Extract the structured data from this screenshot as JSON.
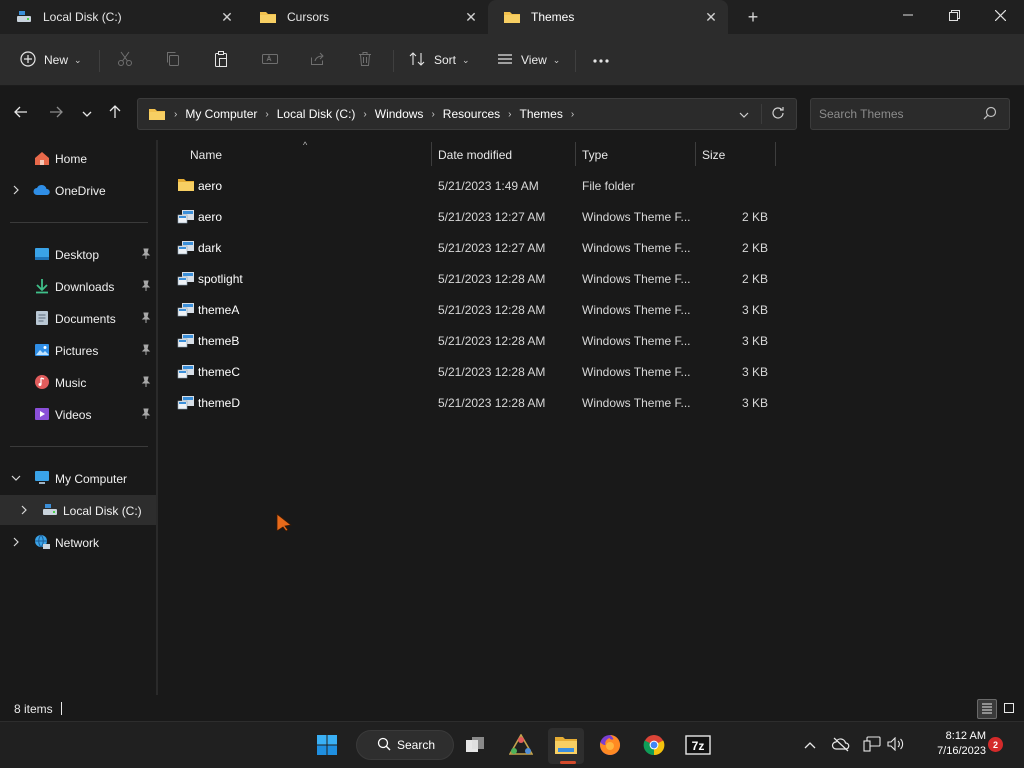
{
  "tabs": [
    {
      "label": "Local Disk (C:)",
      "icon": "drive-icon"
    },
    {
      "label": "Cursors",
      "icon": "folder-icon"
    },
    {
      "label": "Themes",
      "icon": "folder-icon",
      "active": true
    }
  ],
  "toolbar": {
    "new_label": "New",
    "sort_label": "Sort",
    "view_label": "View"
  },
  "breadcrumb": [
    "My Computer",
    "Local Disk (C:)",
    "Windows",
    "Resources",
    "Themes"
  ],
  "search": {
    "placeholder": "Search Themes"
  },
  "sidebar": {
    "quick": [
      {
        "label": "Home",
        "icon": "home-icon"
      },
      {
        "label": "OneDrive",
        "icon": "cloud-icon",
        "expandable": true
      }
    ],
    "pinned": [
      {
        "label": "Desktop",
        "icon": "desktop-icon"
      },
      {
        "label": "Downloads",
        "icon": "download-icon"
      },
      {
        "label": "Documents",
        "icon": "documents-icon"
      },
      {
        "label": "Pictures",
        "icon": "pictures-icon"
      },
      {
        "label": "Music",
        "icon": "music-icon"
      },
      {
        "label": "Videos",
        "icon": "videos-icon"
      }
    ],
    "tree": [
      {
        "label": "My Computer",
        "icon": "computer-icon",
        "expanded": true
      },
      {
        "label": "Local Disk (C:)",
        "icon": "drive-icon",
        "selected": true
      },
      {
        "label": "Network",
        "icon": "network-icon"
      }
    ]
  },
  "columns": {
    "name": "Name",
    "date": "Date modified",
    "type": "Type",
    "size": "Size"
  },
  "files": [
    {
      "name": "aero",
      "date": "5/21/2023 1:49 AM",
      "type": "File folder",
      "size": "",
      "kind": "folder"
    },
    {
      "name": "aero",
      "date": "5/21/2023 12:27 AM",
      "type": "Windows Theme F...",
      "size": "2 KB",
      "kind": "theme"
    },
    {
      "name": "dark",
      "date": "5/21/2023 12:27 AM",
      "type": "Windows Theme F...",
      "size": "2 KB",
      "kind": "theme"
    },
    {
      "name": "spotlight",
      "date": "5/21/2023 12:28 AM",
      "type": "Windows Theme F...",
      "size": "2 KB",
      "kind": "theme"
    },
    {
      "name": "themeA",
      "date": "5/21/2023 12:28 AM",
      "type": "Windows Theme F...",
      "size": "3 KB",
      "kind": "theme"
    },
    {
      "name": "themeB",
      "date": "5/21/2023 12:28 AM",
      "type": "Windows Theme F...",
      "size": "3 KB",
      "kind": "theme"
    },
    {
      "name": "themeC",
      "date": "5/21/2023 12:28 AM",
      "type": "Windows Theme F...",
      "size": "3 KB",
      "kind": "theme"
    },
    {
      "name": "themeD",
      "date": "5/21/2023 12:28 AM",
      "type": "Windows Theme F...",
      "size": "3 KB",
      "kind": "theme"
    }
  ],
  "status": {
    "item_count": "8 items"
  },
  "taskbar": {
    "search_label": "Search",
    "time": "8:12 AM",
    "date": "7/16/2023",
    "notifications": "2"
  },
  "colors": {
    "background": "#191919",
    "accent": "#d34a2b",
    "folder": "#f2c14e"
  }
}
